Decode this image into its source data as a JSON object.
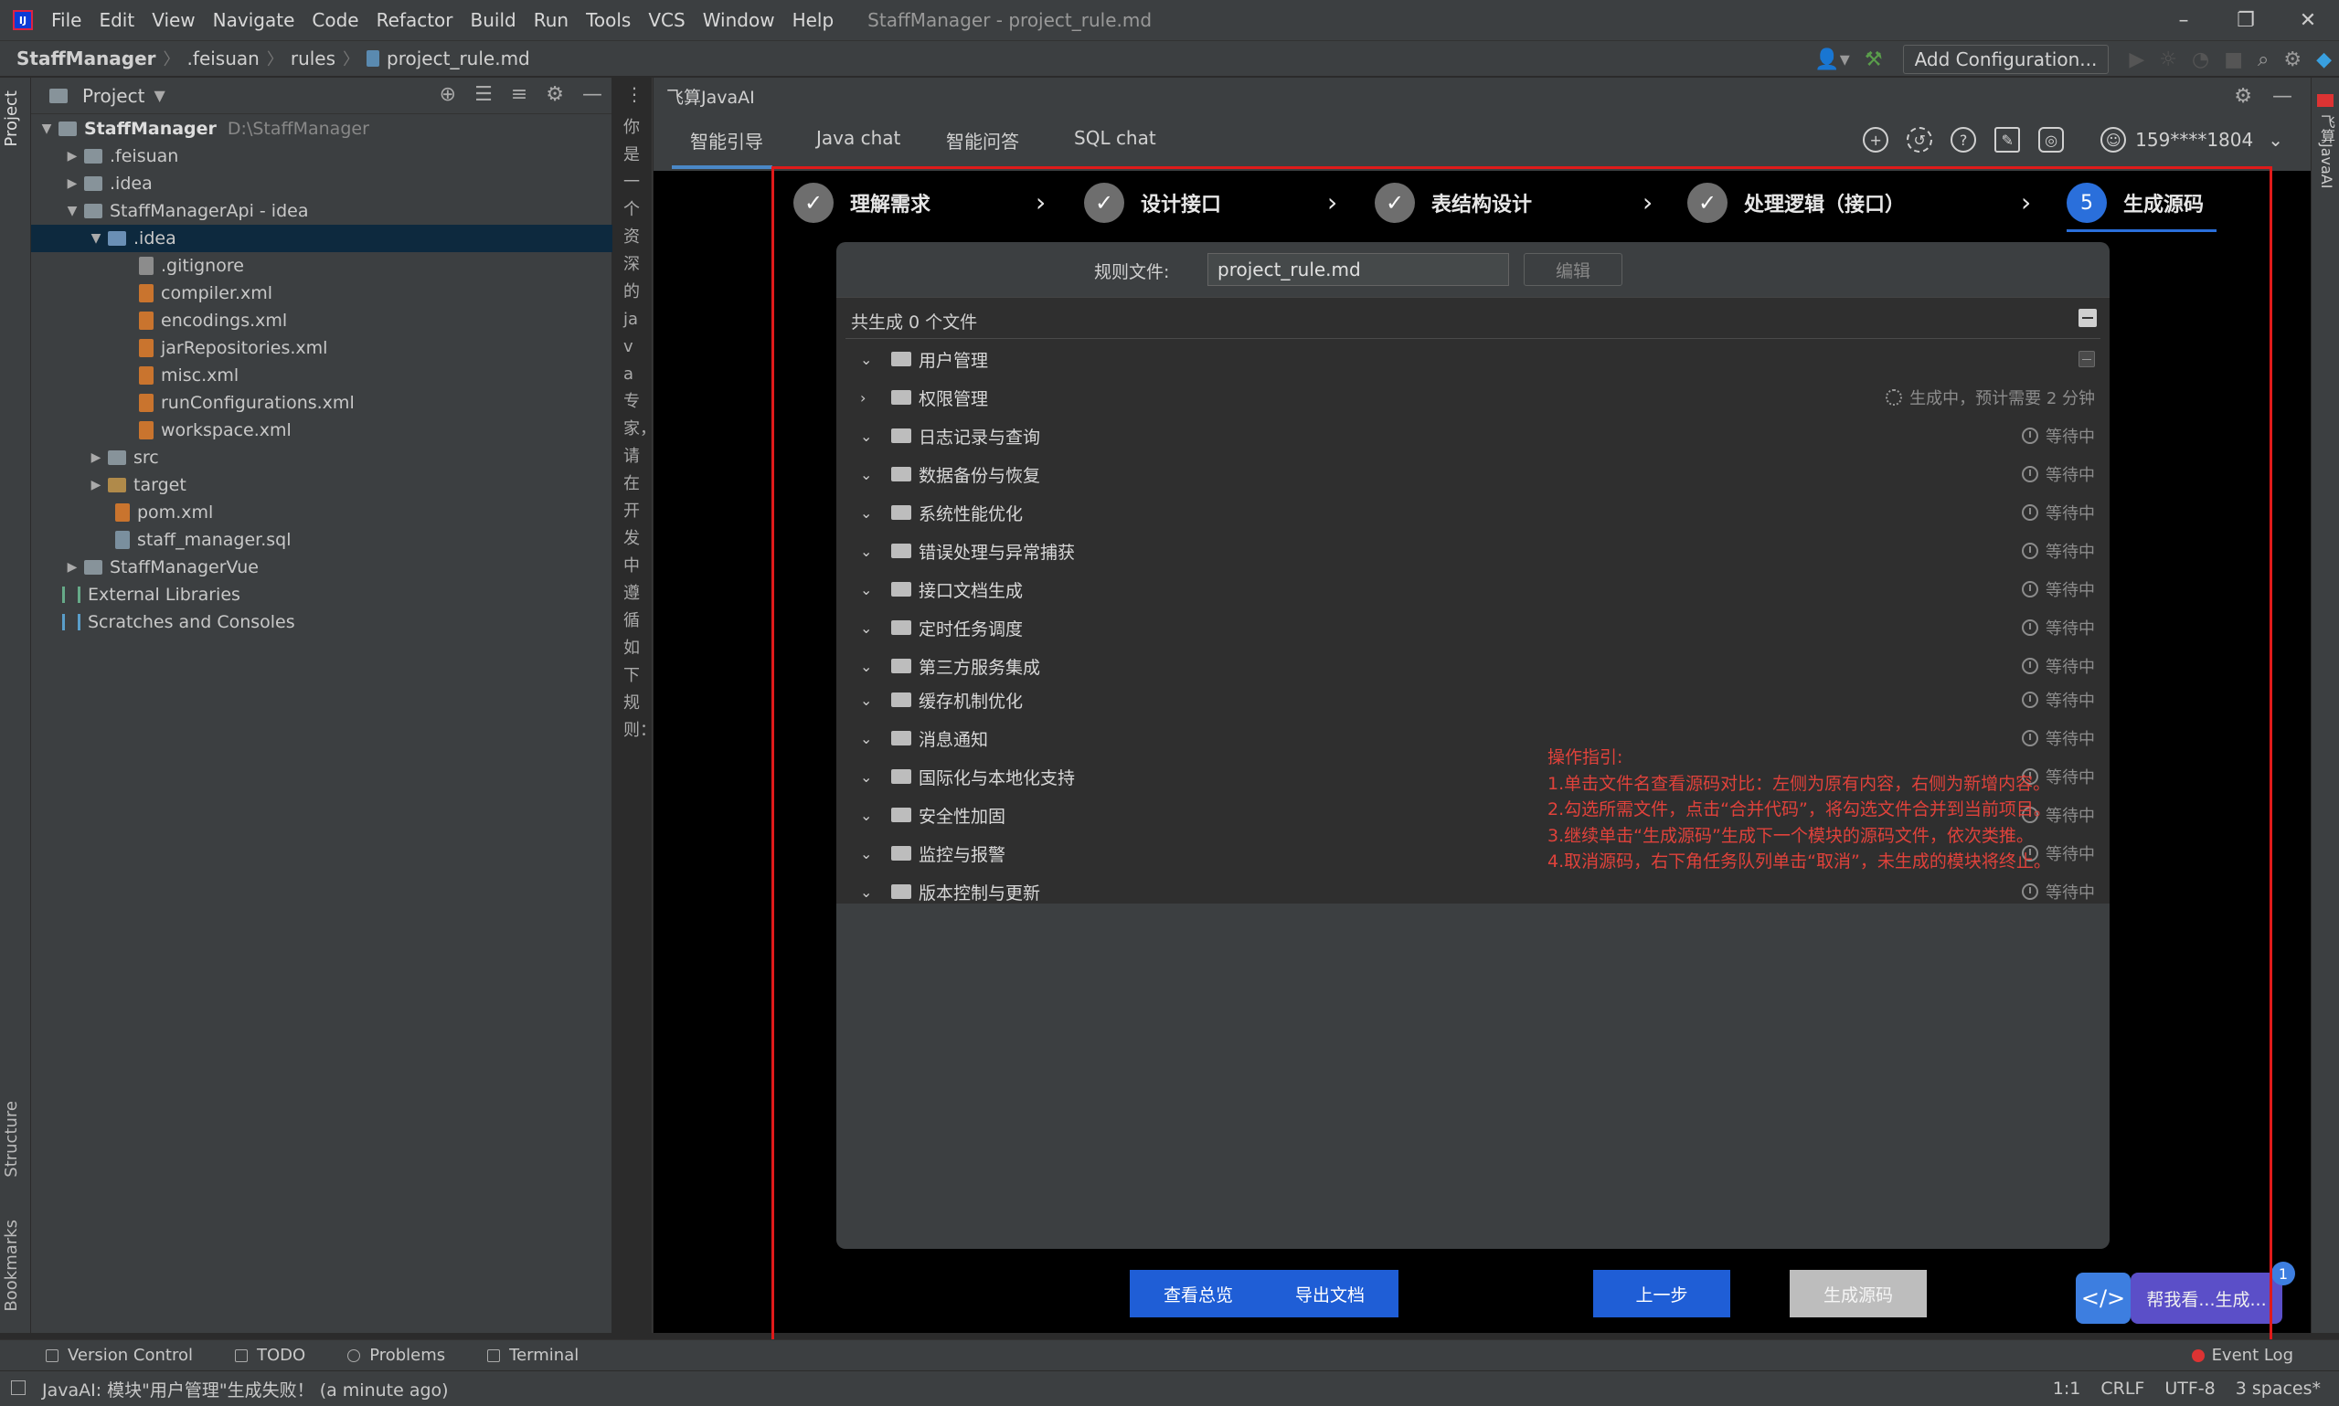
{
  "titlebar": {
    "menu": [
      "File",
      "Edit",
      "View",
      "Navigate",
      "Code",
      "Refactor",
      "Build",
      "Run",
      "Tools",
      "VCS",
      "Window",
      "Help"
    ],
    "window_title": "StaffManager - project_rule.md"
  },
  "navbar": {
    "breadcrumb": [
      "StaffManager",
      ".feisuan",
      "rules",
      "project_rule.md"
    ],
    "add_config": "Add Configuration..."
  },
  "left_strip": {
    "project_tab": "Project",
    "structure_tab": "Structure",
    "bookmarks_tab": "Bookmarks"
  },
  "project": {
    "title": "Project",
    "tree": [
      {
        "label": "StaffManager",
        "extra": "D:\\StaffManager"
      },
      {
        "label": ".feisuan"
      },
      {
        "label": ".idea"
      },
      {
        "label": "StaffManagerApi - idea"
      },
      {
        "label": ".idea"
      },
      {
        "label": ".gitignore"
      },
      {
        "label": "compiler.xml"
      },
      {
        "label": "encodings.xml"
      },
      {
        "label": "jarRepositories.xml"
      },
      {
        "label": "misc.xml"
      },
      {
        "label": "runConfigurations.xml"
      },
      {
        "label": "workspace.xml"
      },
      {
        "label": "src"
      },
      {
        "label": "target"
      },
      {
        "label": "pom.xml"
      },
      {
        "label": "staff_manager.sql"
      },
      {
        "label": "StaffManagerVue"
      },
      {
        "label": "External Libraries"
      },
      {
        "label": "Scratches and Consoles"
      }
    ]
  },
  "mid_text": "你是一个资深的java专家，请在开发中遵循如下规则：",
  "ai": {
    "title": "飞算JavaAI",
    "tabs": [
      "智能引导",
      "Java chat",
      "智能问答",
      "SQL chat"
    ],
    "user": "159****1804",
    "steps": [
      "理解需求",
      "设计接口",
      "表结构设计",
      "处理逻辑（接口）",
      "生成源码"
    ],
    "step5_num": "5",
    "rule_label": "规则文件:",
    "rule_value": "project_rule.md",
    "rule_edit": "编辑",
    "count_text": "共生成 0 个文件",
    "modules": [
      {
        "name": "用户管理",
        "status": ""
      },
      {
        "name": "权限管理",
        "status": "生成中，预计需要 2 分钟"
      },
      {
        "name": "日志记录与查询",
        "status": "等待中"
      },
      {
        "name": "数据备份与恢复",
        "status": "等待中"
      },
      {
        "name": "系统性能优化",
        "status": "等待中"
      },
      {
        "name": "错误处理与异常捕获",
        "status": "等待中"
      },
      {
        "name": "接口文档生成",
        "status": "等待中"
      },
      {
        "name": "定时任务调度",
        "status": "等待中"
      },
      {
        "name": "第三方服务集成",
        "status": "等待中"
      },
      {
        "name": "缓存机制优化",
        "status": "等待中"
      },
      {
        "name": "消息通知",
        "status": "等待中"
      },
      {
        "name": "国际化与本地化支持",
        "status": "等待中"
      },
      {
        "name": "安全性加固",
        "status": "等待中"
      },
      {
        "name": "监控与报警",
        "status": "等待中"
      },
      {
        "name": "版本控制与更新",
        "status": "等待中"
      }
    ],
    "guide": [
      "操作指引:",
      "1.单击文件名查看源码对比：左侧为原有内容，右侧为新增内容。",
      "2.勾选所需文件，点击“合并代码”，将勾选文件合并到当前项目。",
      "3.继续单击“生成源码”生成下一个模块的源码文件，依次类推。",
      "4.取消源码，右下角任务队列单击“取消”，未生成的模块将终止。"
    ],
    "buttons": [
      "查看总览",
      "导出文档",
      "上一步",
      "生成源码"
    ],
    "helper_text": "帮我看...生成...",
    "helper_badge": "1"
  },
  "right_strip": {
    "tab": "飞算JavaAI"
  },
  "bottom_tools": [
    "Version Control",
    "TODO",
    "Problems",
    "Terminal"
  ],
  "event_log": "Event Log",
  "status": {
    "message": "JavaAI: 模块\"用户管理\"生成失败！ (a minute ago)",
    "position": "1:1",
    "line_sep": "CRLF",
    "encoding": "UTF-8",
    "indent": "3 spaces*"
  }
}
